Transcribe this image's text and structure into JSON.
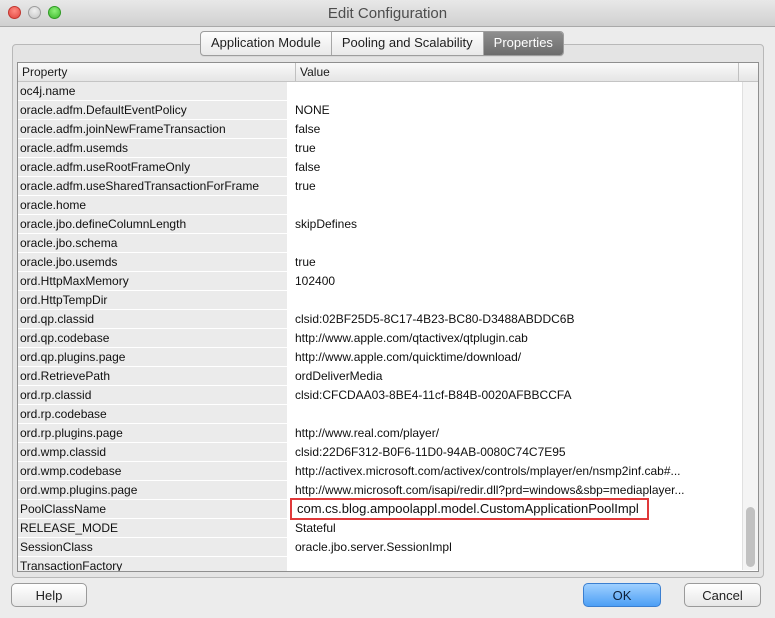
{
  "window": {
    "title": "Edit Configuration"
  },
  "tabs": [
    {
      "label": "Application Module",
      "active": false
    },
    {
      "label": "Pooling and Scalability",
      "active": false
    },
    {
      "label": "Properties",
      "active": true
    }
  ],
  "table": {
    "columns": [
      "Property",
      "Value"
    ],
    "rows": [
      {
        "name": "oc4j.name",
        "value": ""
      },
      {
        "name": "oracle.adfm.DefaultEventPolicy",
        "value": "NONE"
      },
      {
        "name": "oracle.adfm.joinNewFrameTransaction",
        "value": "false"
      },
      {
        "name": "oracle.adfm.usemds",
        "value": "true"
      },
      {
        "name": "oracle.adfm.useRootFrameOnly",
        "value": "false"
      },
      {
        "name": "oracle.adfm.useSharedTransactionForFrame",
        "value": "true"
      },
      {
        "name": "oracle.home",
        "value": ""
      },
      {
        "name": "oracle.jbo.defineColumnLength",
        "value": "skipDefines"
      },
      {
        "name": "oracle.jbo.schema",
        "value": ""
      },
      {
        "name": "oracle.jbo.usemds",
        "value": "true"
      },
      {
        "name": "ord.HttpMaxMemory",
        "value": "102400"
      },
      {
        "name": "ord.HttpTempDir",
        "value": ""
      },
      {
        "name": "ord.qp.classid",
        "value": "clsid:02BF25D5-8C17-4B23-BC80-D3488ABDDC6B"
      },
      {
        "name": "ord.qp.codebase",
        "value": "http://www.apple.com/qtactivex/qtplugin.cab"
      },
      {
        "name": "ord.qp.plugins.page",
        "value": "http://www.apple.com/quicktime/download/"
      },
      {
        "name": "ord.RetrievePath",
        "value": "ordDeliverMedia"
      },
      {
        "name": "ord.rp.classid",
        "value": "clsid:CFCDAA03-8BE4-11cf-B84B-0020AFBBCCFA"
      },
      {
        "name": "ord.rp.codebase",
        "value": ""
      },
      {
        "name": "ord.rp.plugins.page",
        "value": "http://www.real.com/player/"
      },
      {
        "name": "ord.wmp.classid",
        "value": "clsid:22D6F312-B0F6-11D0-94AB-0080C74C7E95"
      },
      {
        "name": "ord.wmp.codebase",
        "value": "http://activex.microsoft.com/activex/controls/mplayer/en/nsmp2inf.cab#..."
      },
      {
        "name": "ord.wmp.plugins.page",
        "value": "http://www.microsoft.com/isapi/redir.dll?prd=windows&sbp=mediaplayer..."
      },
      {
        "name": "PoolClassName",
        "value": ""
      },
      {
        "name": "RELEASE_MODE",
        "value": "Stateful"
      },
      {
        "name": "SessionClass",
        "value": "oracle.jbo.server.SessionImpl"
      },
      {
        "name": "TransactionFactory",
        "value": ""
      }
    ]
  },
  "editor": {
    "value": "com.cs.blog.ampoolappl.model.CustomApplicationPoolImpl"
  },
  "buttons": {
    "help": "Help",
    "ok": "OK",
    "cancel": "Cancel"
  },
  "colors": {
    "highlight_border": "#e0393a",
    "ok_button": "#4d9ff5"
  }
}
